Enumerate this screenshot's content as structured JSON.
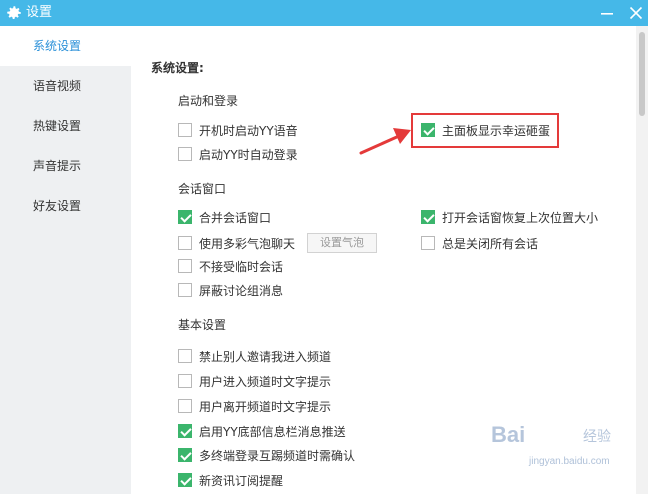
{
  "window": {
    "title": "设置",
    "icon": "gear-icon",
    "controls": {
      "minimize": "minimize-icon",
      "close": "close-icon"
    }
  },
  "sidebar": {
    "items": [
      {
        "label": "系统设置",
        "active": true
      },
      {
        "label": "语音视频",
        "active": false
      },
      {
        "label": "热键设置",
        "active": false
      },
      {
        "label": "声音提示",
        "active": false
      },
      {
        "label": "好友设置",
        "active": false
      }
    ]
  },
  "main": {
    "heading": "系统设置:",
    "startup": {
      "title": "启动和登录",
      "options": [
        {
          "label": "开机时启动YY语音",
          "checked": false
        },
        {
          "label": "启动YY时自动登录",
          "checked": false
        },
        {
          "label": "主面板显示幸运砸蛋",
          "checked": true
        }
      ]
    },
    "session": {
      "title": "会话窗口",
      "options": [
        {
          "label": "合并会话窗口",
          "checked": true
        },
        {
          "label": "使用多彩气泡聊天",
          "checked": false
        },
        {
          "label": "不接受临时会话",
          "checked": false
        },
        {
          "label": "屏蔽讨论组消息",
          "checked": false
        },
        {
          "label": "打开会话窗恢复上次位置大小",
          "checked": true
        },
        {
          "label": "总是关闭所有会话",
          "checked": false
        }
      ],
      "bubble_button": "设置气泡"
    },
    "basic": {
      "title": "基本设置",
      "options": [
        {
          "label": "禁止别人邀请我进入频道",
          "checked": false
        },
        {
          "label": "用户进入频道时文字提示",
          "checked": false
        },
        {
          "label": "用户离开频道时文字提示",
          "checked": false
        },
        {
          "label": "启用YY底部信息栏消息推送",
          "checked": true
        },
        {
          "label": "多终端登录互踢频道时需确认",
          "checked": true
        },
        {
          "label": "新资讯订阅提醒",
          "checked": true
        }
      ]
    }
  },
  "annotation": {
    "color": "#e43a3a"
  },
  "watermark": {
    "logo": "Bai",
    "brand": "经验",
    "url": "jingyan.baidu.com"
  },
  "colors": {
    "titlebar": "#45b8e8",
    "active_text": "#2a90d8",
    "checkbox_checked": "#3bb56c",
    "sidebar_bg": "#eef0f2"
  }
}
